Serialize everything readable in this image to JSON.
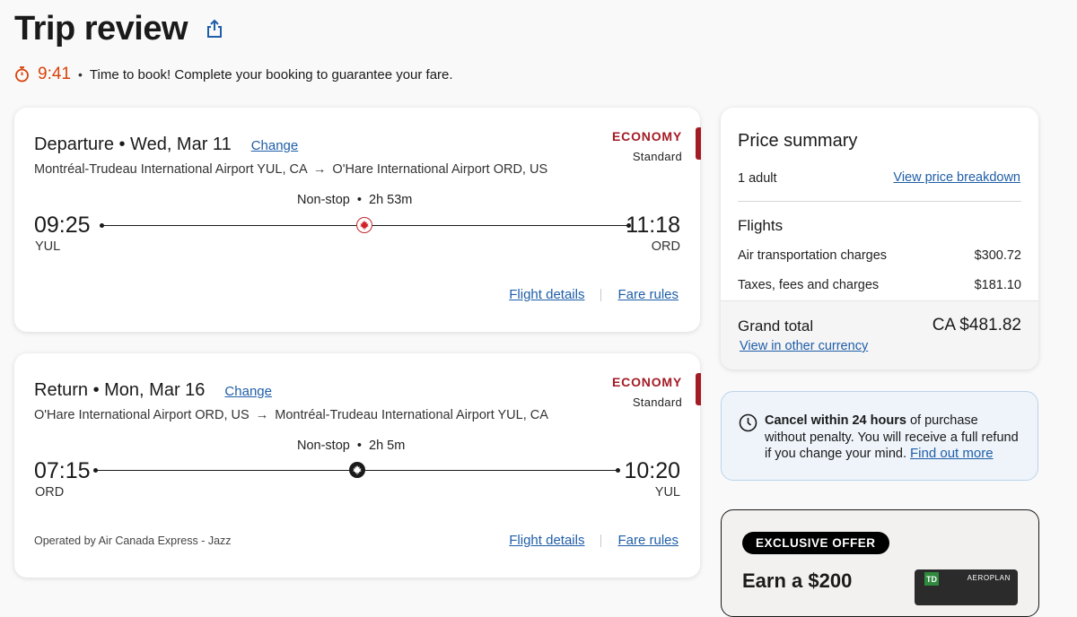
{
  "header": {
    "title": "Trip review"
  },
  "timer": {
    "time": "9:41",
    "separator": "•",
    "message": "Time to book! Complete your booking to guarantee your fare."
  },
  "departure": {
    "heading": "Departure • Wed, Mar 11",
    "change_label": "Change",
    "origin_airport": "Montréal-Trudeau International Airport YUL, CA",
    "arrow": "→",
    "destination_airport": "O'Hare International Airport ORD, US",
    "cabin": "ECONOMY",
    "fare": "Standard",
    "stops": "Non-stop  •  2h 53m",
    "depart_time": "09:25",
    "depart_code": "YUL",
    "arrive_time": "11:18",
    "arrive_code": "ORD",
    "flight_details_label": "Flight details",
    "fare_rules_label": "Fare rules"
  },
  "return": {
    "heading": "Return • Mon, Mar 16",
    "change_label": "Change",
    "origin_airport": "O'Hare International Airport ORD, US",
    "arrow": "→",
    "destination_airport": "Montréal-Trudeau International Airport YUL, CA",
    "cabin": "ECONOMY",
    "fare": "Standard",
    "stops": "Non-stop  •  2h 5m",
    "depart_time": "07:15",
    "depart_code": "ORD",
    "arrive_time": "10:20",
    "arrive_code": "YUL",
    "operated_by": "Operated by Air Canada Express - Jazz",
    "flight_details_label": "Flight details",
    "fare_rules_label": "Fare rules"
  },
  "price_summary": {
    "title": "Price summary",
    "passengers": "1 adult",
    "breakdown_link": "View price breakdown",
    "flights_heading": "Flights",
    "air_charges_label": "Air transportation charges",
    "air_charges_value": "$300.72",
    "taxes_label": "Taxes, fees and charges",
    "taxes_value": "$181.10",
    "grand_total_label": "Grand total",
    "grand_total_value": "CA $481.82",
    "currency_link": "View in other currency"
  },
  "cancel_info": {
    "bold": "Cancel within 24 hours",
    "text": " of purchase without penalty. You will receive a full refund if you change your mind.",
    "link": "Find out more"
  },
  "offer": {
    "badge": "EXCLUSIVE OFFER",
    "heading": "Earn a $200",
    "card_bank": "TD",
    "card_program": "AEROPLAN"
  },
  "colors": {
    "accent_red": "#a31b25",
    "timer_orange": "#d8410a",
    "link_blue": "#1f5ea8",
    "info_bg": "#eef4fa"
  },
  "icons": {
    "share": "share-icon",
    "timer": "stopwatch-icon",
    "maple_leaf": "maple-leaf-icon",
    "jazz": "air-canada-express-icon",
    "clock": "clock-icon"
  }
}
